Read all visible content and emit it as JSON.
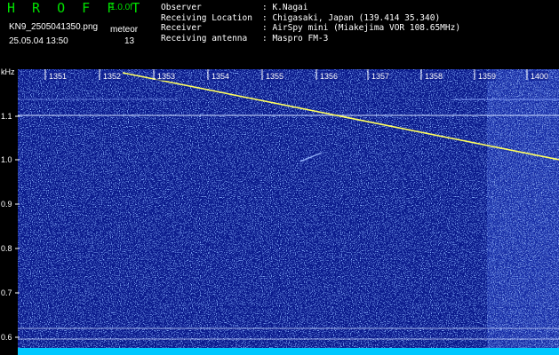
{
  "header": {
    "app_title": "H R O F F T",
    "version": "1.0.0f",
    "filename": "KN9_2505041350.png",
    "meteor_label": "meteor",
    "datetime": "25.05.04 13:50",
    "meteor_count": "13"
  },
  "info": [
    {
      "key": "Observer",
      "value": ": K.Nagai"
    },
    {
      "key": "Receiving Location",
      "value": ": Chigasaki, Japan (139.414 35.340)"
    },
    {
      "key": "Receiver",
      "value": ": AirSpy mini (Miakejima VOR 108.65MHz)"
    },
    {
      "key": "Receiving antenna",
      "value": ": Maspro FM-3"
    }
  ],
  "axis": {
    "unit": "kHz",
    "time_ticks": [
      "1351",
      "1352",
      "1353",
      "1354",
      "1355",
      "1356",
      "1357",
      "1358",
      "1359",
      "1400"
    ],
    "freq_ticks": [
      "1.1",
      "1.0",
      "0.9",
      "0.8",
      "0.7",
      "0.6"
    ]
  },
  "colors": {
    "background": "#0a1a8c",
    "noise": "#3a6cff",
    "trace": "#ffff60",
    "carrier": "#c8d8ff",
    "label": "#ffffff"
  }
}
